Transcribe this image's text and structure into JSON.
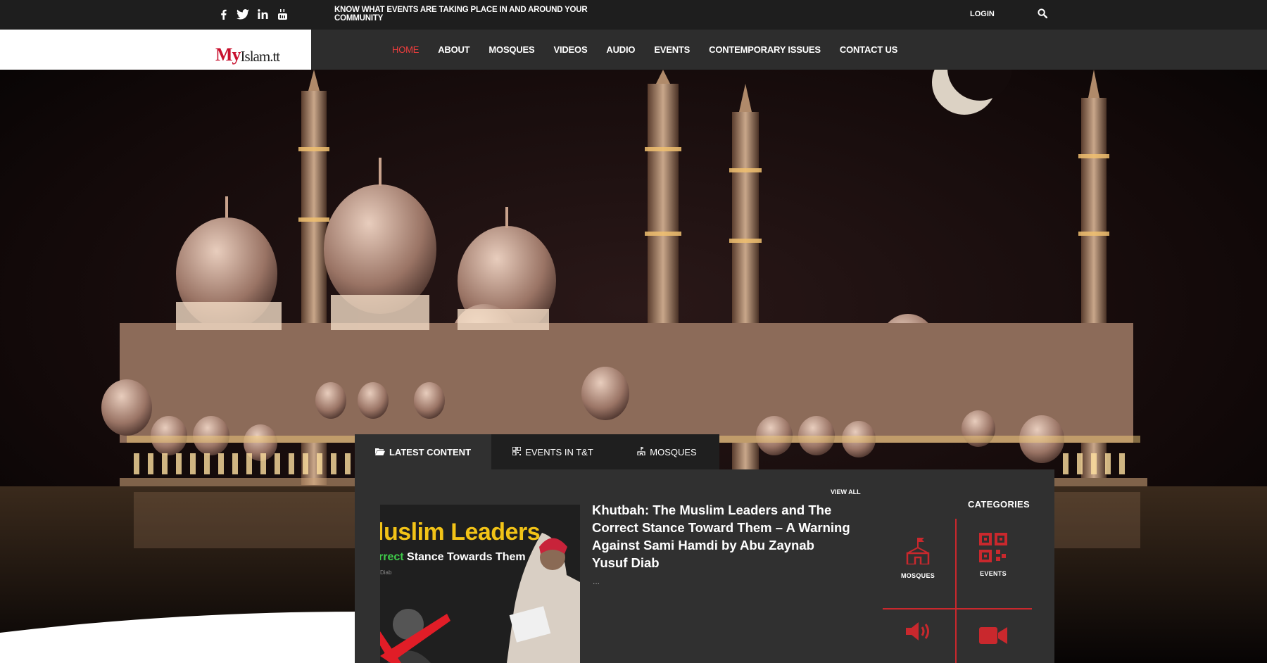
{
  "topbar": {
    "social_icons": [
      "facebook-icon",
      "twitter-icon",
      "linkedin-icon",
      "youtube-icon"
    ],
    "tagline": "KNOW WHAT EVENTS ARE TAKING PLACE IN AND AROUND YOUR COMMUNITY",
    "login": "LOGIN",
    "search_icon": "search-icon"
  },
  "logo": {
    "mark": "My",
    "text": "Islam.tt"
  },
  "nav": {
    "items": [
      "HOME",
      "ABOUT",
      "MOSQUES",
      "VIDEOS",
      "AUDIO",
      "EVENTS",
      "CONTEMPORARY ISSUES",
      "CONTACT US"
    ],
    "active": "HOME"
  },
  "tabs": [
    {
      "label": "LATEST CONTENT",
      "icon": "folder-open-icon"
    },
    {
      "label": "EVENTS IN T&T",
      "icon": "qr-code-icon"
    },
    {
      "label": "MOSQUES",
      "icon": "mosque-icon"
    }
  ],
  "content": {
    "view_all": "VIEW ALL",
    "thumbnail": {
      "line1": "luslim Leaders",
      "line2_green": "rrect",
      "line2_white": " Stance Towards Them",
      "line3": "Diab"
    },
    "article_title": "Khutbah: The Muslim Leaders and The Correct Stance Toward Them – A Warning Against Sami Hamdi by Abu Zaynab Yusuf Diab",
    "excerpt": "..."
  },
  "categories": {
    "title": "CATEGORIES",
    "items": [
      {
        "label": "MOSQUES",
        "icon": "mosque-flag-icon"
      },
      {
        "label": "EVENTS",
        "icon": "qr-code-icon"
      },
      {
        "label": "",
        "icon": "speaker-icon"
      },
      {
        "label": "",
        "icon": "video-camera-icon"
      }
    ]
  },
  "colors": {
    "accent": "#c9282d",
    "active_nav": "#ee3d3d",
    "topbar": "#1e1e1e",
    "navbar": "#2d2d2d",
    "panel": "#303030"
  }
}
